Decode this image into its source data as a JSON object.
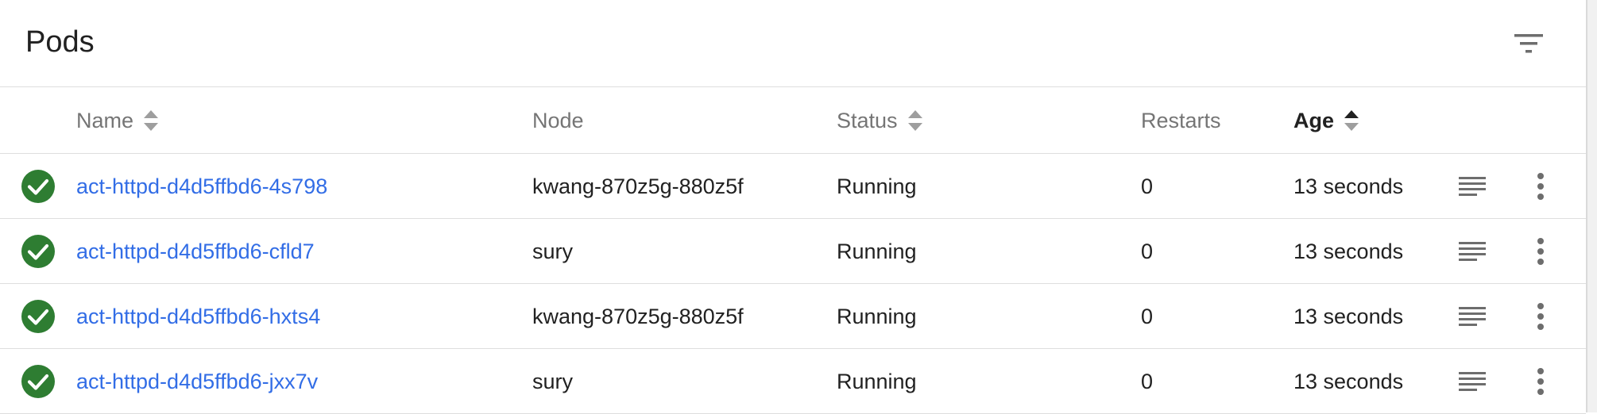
{
  "card": {
    "title": "Pods"
  },
  "columns": {
    "name": "Name",
    "node": "Node",
    "status": "Status",
    "restarts": "Restarts",
    "age": "Age"
  },
  "rows": [
    {
      "name": "act-httpd-d4d5ffbd6-4s798",
      "node": "kwang-870z5g-880z5f",
      "status": "Running",
      "restarts": "0",
      "age": "13 seconds"
    },
    {
      "name": "act-httpd-d4d5ffbd6-cfld7",
      "node": "sury",
      "status": "Running",
      "restarts": "0",
      "age": "13 seconds"
    },
    {
      "name": "act-httpd-d4d5ffbd6-hxts4",
      "node": "kwang-870z5g-880z5f",
      "status": "Running",
      "restarts": "0",
      "age": "13 seconds"
    },
    {
      "name": "act-httpd-d4d5ffbd6-jxx7v",
      "node": "sury",
      "status": "Running",
      "restarts": "0",
      "age": "13 seconds"
    }
  ],
  "icons": {
    "status": "check-circle-icon",
    "logs": "logs-icon",
    "menu": "more-vert-icon",
    "filter": "filter-icon"
  },
  "colors": {
    "success": "#2e7d32",
    "link": "#326de6",
    "text": "#212121",
    "muted": "#757575",
    "divider": "#dedede"
  },
  "sort": {
    "active_column": "age",
    "direction": "ascending"
  }
}
